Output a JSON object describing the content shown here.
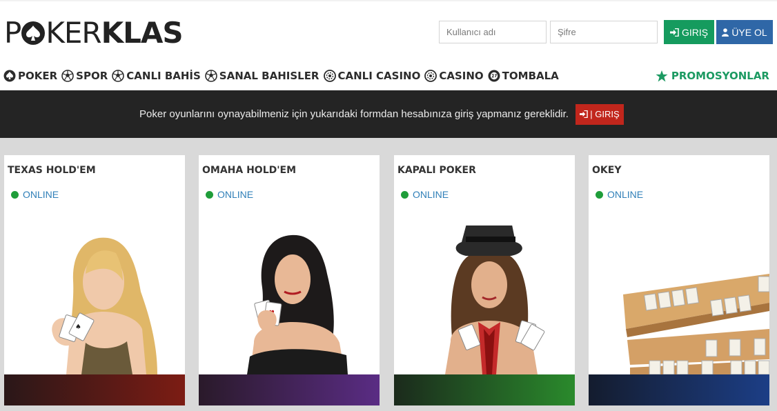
{
  "header": {
    "logo_left": "P",
    "logo_mid": "KER",
    "logo_bold": "KLAS",
    "username_placeholder": "Kullanıcı adı",
    "password_placeholder": "Şifre",
    "login_label": "GIRIŞ",
    "register_label": "ÜYE OL"
  },
  "nav": {
    "items": [
      {
        "label": "POKER",
        "icon": "spade-icon"
      },
      {
        "label": "SPOR",
        "icon": "soccer-ball-icon"
      },
      {
        "label": "CANLI BAHİS",
        "icon": "soccer-ball-icon"
      },
      {
        "label": "SANAL BAHISLER",
        "icon": "soccer-ball-icon"
      },
      {
        "label": "CANLI CASINO",
        "icon": "chip-icon"
      },
      {
        "label": "CASINO",
        "icon": "chip-icon"
      },
      {
        "label": "TOMBALA",
        "icon": "bingo-ball-icon"
      }
    ],
    "promo_label": "PROMOSYONLAR",
    "promo_icon": "star-icon"
  },
  "notice": {
    "text": "Poker oyunlarını oynayabilmeniz için yukarıdaki formdan hesabınıza giriş yapmanız gereklidir.",
    "button_label": "| GIRIŞ"
  },
  "games": [
    {
      "title": "TEXAS HOLD'EM",
      "status": "ONLINE",
      "bar_from": "#2a1718",
      "bar_to": "#7c1c14"
    },
    {
      "title": "OMAHA HOLD'EM",
      "status": "ONLINE",
      "bar_from": "#2a1a2a",
      "bar_to": "#5a2c84"
    },
    {
      "title": "KAPALI POKER",
      "status": "ONLINE",
      "bar_from": "#1b2a1c",
      "bar_to": "#2a8a2c"
    },
    {
      "title": "OKEY",
      "status": "ONLINE",
      "bar_from": "#141c2e",
      "bar_to": "#1c3e86"
    }
  ],
  "colors": {
    "login_green": "#159b5e",
    "register_blue": "#2f67a7",
    "notice_red": "#c1261c",
    "online_green": "#1f9d3a",
    "promo_green": "#1c9a62"
  }
}
